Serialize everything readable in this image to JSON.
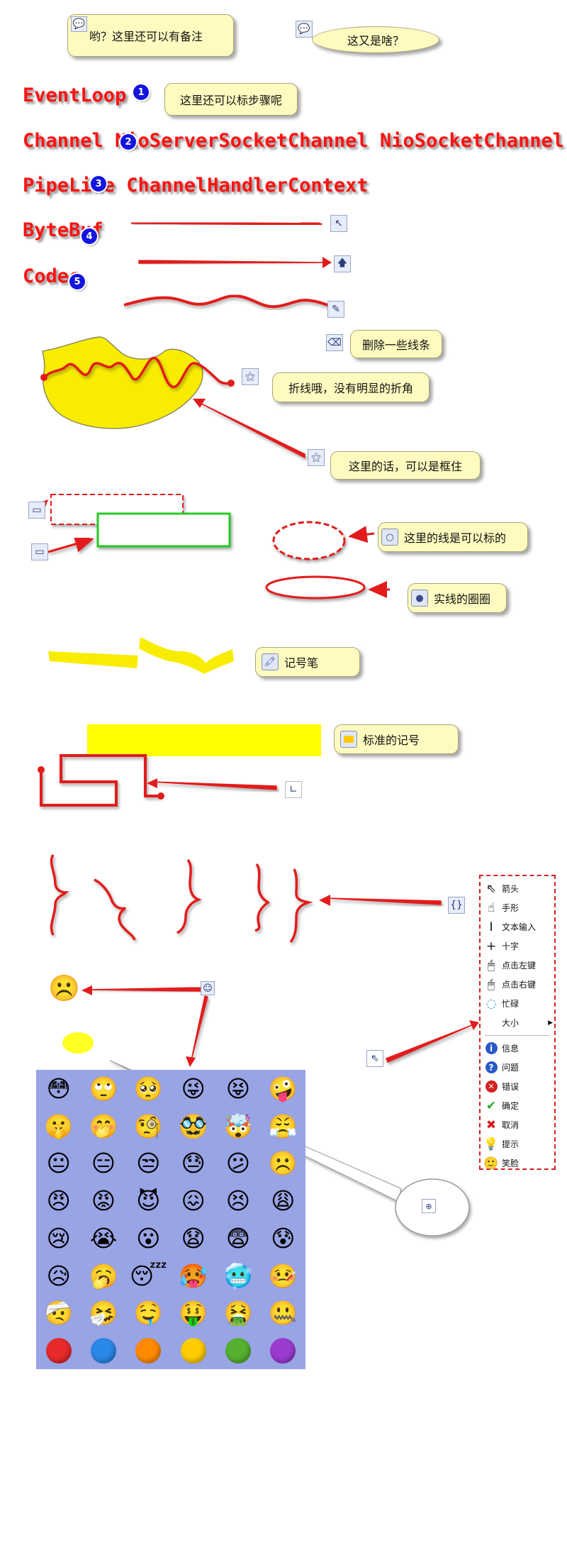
{
  "notes": {
    "bubble1": "哟？这里还可以有备注",
    "bubble2": "这又是啥？",
    "step_note": "这里还可以标步骤呢",
    "delete_lines": "删除一些线条",
    "polyline": "折线哦，没有明显的折角",
    "frame_note": "这里的话，可以是框住",
    "dashed_ellipse": "这里的线是可以标的",
    "solid_ellipse": "实线的圈圈",
    "marker_pen": "记号笔",
    "standard_marker": "标准的记号"
  },
  "labels": {
    "eventloop": "EventLoop",
    "channel": "Channel NioServerSocketChannel NioSocketChannel",
    "pipeline": "PipeLine ChannelHandlerContext",
    "bytebuf": "ByteBuf",
    "codec": "Codec"
  },
  "steps": [
    "1",
    "2",
    "3",
    "4",
    "5"
  ],
  "menu": {
    "items": [
      {
        "label": "箭头",
        "icon": "arrow-cursor-icon"
      },
      {
        "label": "手形",
        "icon": "hand-cursor-icon"
      },
      {
        "label": "文本输入",
        "icon": "ibeam-cursor-icon"
      },
      {
        "label": "十字",
        "icon": "crosshair-cursor-icon"
      },
      {
        "label": "点击左键",
        "icon": "mouse-left-icon"
      },
      {
        "label": "点击右键",
        "icon": "mouse-right-icon"
      },
      {
        "label": "忙碌",
        "icon": "busy-icon"
      },
      {
        "label": "大小",
        "icon": "size-icon"
      },
      {
        "label": "信息",
        "icon": "info-icon"
      },
      {
        "label": "问题",
        "icon": "question-icon"
      },
      {
        "label": "错误",
        "icon": "error-icon"
      },
      {
        "label": "确定",
        "icon": "check-icon"
      },
      {
        "label": "取消",
        "icon": "cancel-icon"
      },
      {
        "label": "提示",
        "icon": "bulb-icon"
      },
      {
        "label": "笑脸",
        "icon": "smiley-icon"
      }
    ]
  },
  "emoji": [
    "😳",
    "🙄",
    "🥺",
    "😜",
    "😝",
    "🤪",
    "🤫",
    "🤭",
    "🧐",
    "🥸",
    "🤯",
    "😤",
    "😐",
    "😑",
    "😒",
    "😓",
    "😕",
    "☹️",
    "😠",
    "😡",
    "😈",
    "😖",
    "😣",
    "😩",
    "😢",
    "😭",
    "😮",
    "😧",
    "😨",
    "😰",
    "😥",
    "🥱",
    "😴",
    "🥵",
    "🥶",
    "🤒",
    "🤕",
    "🤧",
    "🤤",
    "🤑",
    "🤮",
    "🤐"
  ],
  "color_dots": [
    "#e82a2a",
    "#2a88e8",
    "#ff8a00",
    "#ffcc00",
    "#55b030",
    "#9b3bd0"
  ],
  "colors": {
    "annotation_red": "#e21c1c",
    "highlight_yellow": "#ffff00",
    "note_fill": "#fffbc0",
    "frame_green": "#22cc22",
    "step_blue": "#1414e0",
    "emoji_panel": "#98a4e4"
  },
  "icons": {
    "note_icon": "speech-bubble-icon",
    "frowny": "frowning-face-icon"
  }
}
